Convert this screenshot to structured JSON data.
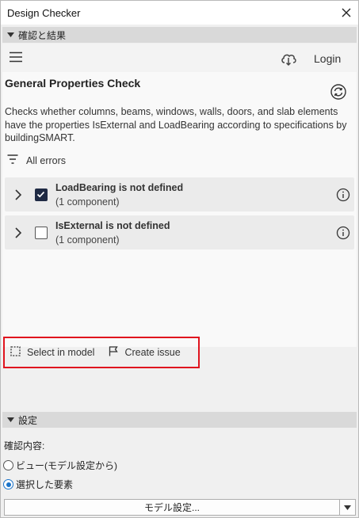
{
  "window": {
    "title": "Design Checker"
  },
  "sections": {
    "results_header": "確認と結果",
    "settings_header": "設定"
  },
  "topbar": {
    "login_label": "Login"
  },
  "check": {
    "title": "General Properties Check",
    "description": "Checks whether columns, beams, windows, walls, doors, and slab elements have the properties IsExternal and LoadBearing according to specifications by buildingSMART.",
    "filter_label": "All errors"
  },
  "rules": [
    {
      "name": "LoadBearing is not defined",
      "count": "(1 component)",
      "checked": true
    },
    {
      "name": "IsExternal is not defined",
      "count": "(1 component)",
      "checked": false
    }
  ],
  "actions": {
    "select_label": "Select in model",
    "issue_label": "Create issue"
  },
  "settings": {
    "confirm_label": "確認内容:",
    "option_view": "ビュー(モデル設定から)",
    "option_selected": "選択した要素",
    "selected_option": "選択した要素",
    "model_settings_label": "モデル設定..."
  },
  "colors": {
    "highlight_border": "#e0141e",
    "checkbox_checked": "#1f2a44",
    "radio_accent": "#1a73c9",
    "section_header_bg": "#d9d9d9"
  }
}
